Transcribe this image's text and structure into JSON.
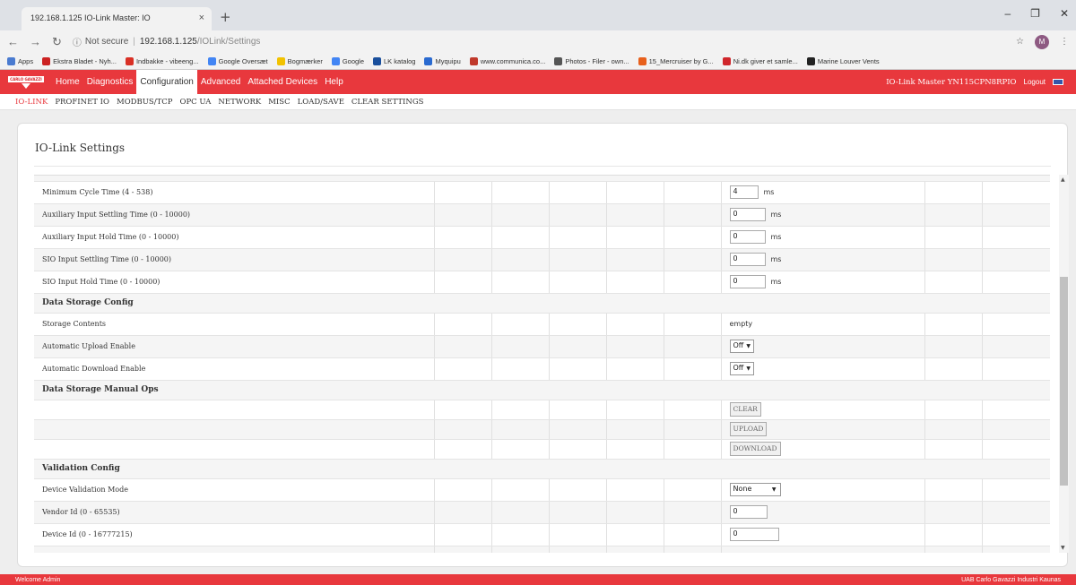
{
  "browser": {
    "tab_title": "192.168.1.125 IO-Link Master: IO",
    "tab_close": "×",
    "new_tab": "+",
    "url_warning": "Not secure",
    "url_host": "192.168.1.125",
    "url_path": "/IOLink/Settings",
    "avatar_letter": "M",
    "bookmarks": [
      {
        "label": "Apps",
        "color": "#4a7bd0"
      },
      {
        "label": "Ekstra Bladet - Nyh...",
        "color": "#cc2222"
      },
      {
        "label": "Indbakke - vibeeng...",
        "color": "#d93025"
      },
      {
        "label": "Google Oversæt",
        "color": "#4285f4"
      },
      {
        "label": "Bogmærker",
        "color": "#f2c200"
      },
      {
        "label": "Google",
        "color": "#4285f4"
      },
      {
        "label": "LK katalog",
        "color": "#1a4f9c"
      },
      {
        "label": "Myquipu",
        "color": "#2a6ad0"
      },
      {
        "label": "www.communica.co...",
        "color": "#c0392b"
      },
      {
        "label": "Photos - Filer - own...",
        "color": "#555555"
      },
      {
        "label": "15_Mercruiser by G...",
        "color": "#e8601c"
      },
      {
        "label": "Ni.dk giver et samle...",
        "color": "#d0262b"
      },
      {
        "label": "Marine Louver Vents",
        "color": "#222222"
      }
    ]
  },
  "header": {
    "logo_text": "CARLO GAVAZZI",
    "nav": [
      "Home",
      "Diagnostics",
      "Configuration",
      "Advanced",
      "Attached Devices",
      "Help"
    ],
    "active_nav": "Configuration",
    "device_title": "IO-Link Master YN115CPN8RPIO",
    "logout": "Logout"
  },
  "subnav": [
    "IO-LINK",
    "PROFINET IO",
    "MODBUS/TCP",
    "OPC UA",
    "NETWORK",
    "MISC",
    "LOAD/SAVE",
    "CLEAR SETTINGS"
  ],
  "panel": {
    "title": "IO-Link Settings",
    "rows": {
      "min_cycle": {
        "label": "Minimum Cycle Time (4 - 538)",
        "value": "4",
        "unit": "ms"
      },
      "aux_settle": {
        "label": "Auxiliary Input Settling Time (0 - 10000)",
        "value": "0",
        "unit": "ms"
      },
      "aux_hold": {
        "label": "Auxiliary Input Hold Time (0 - 10000)",
        "value": "0",
        "unit": "ms"
      },
      "sio_settle": {
        "label": "SIO Input Settling Time (0 - 10000)",
        "value": "0",
        "unit": "ms"
      },
      "sio_hold": {
        "label": "SIO Input Hold Time (0 - 10000)",
        "value": "0",
        "unit": "ms"
      },
      "ds_config": {
        "label": "Data Storage Config"
      },
      "storage_contents": {
        "label": "Storage Contents",
        "value": "empty"
      },
      "auto_upload": {
        "label": "Automatic Upload Enable",
        "value": "Off"
      },
      "auto_download": {
        "label": "Automatic Download Enable",
        "value": "Off"
      },
      "ds_manual": {
        "label": "Data Storage Manual Ops"
      },
      "clear_btn": "CLEAR",
      "upload_btn": "UPLOAD",
      "download_btn": "DOWNLOAD",
      "validation": {
        "label": "Validation Config"
      },
      "validation_mode": {
        "label": "Device Validation Mode",
        "value": "None"
      },
      "vendor_id": {
        "label": "Vendor Id (0 - 65535)",
        "value": "0"
      },
      "device_id": {
        "label": "Device Id (0 - 16777215)",
        "value": "0"
      }
    }
  },
  "footer": {
    "left": "Welcome Admin",
    "right": "UAB Carlo Gavazzi Industri Kaunas"
  }
}
